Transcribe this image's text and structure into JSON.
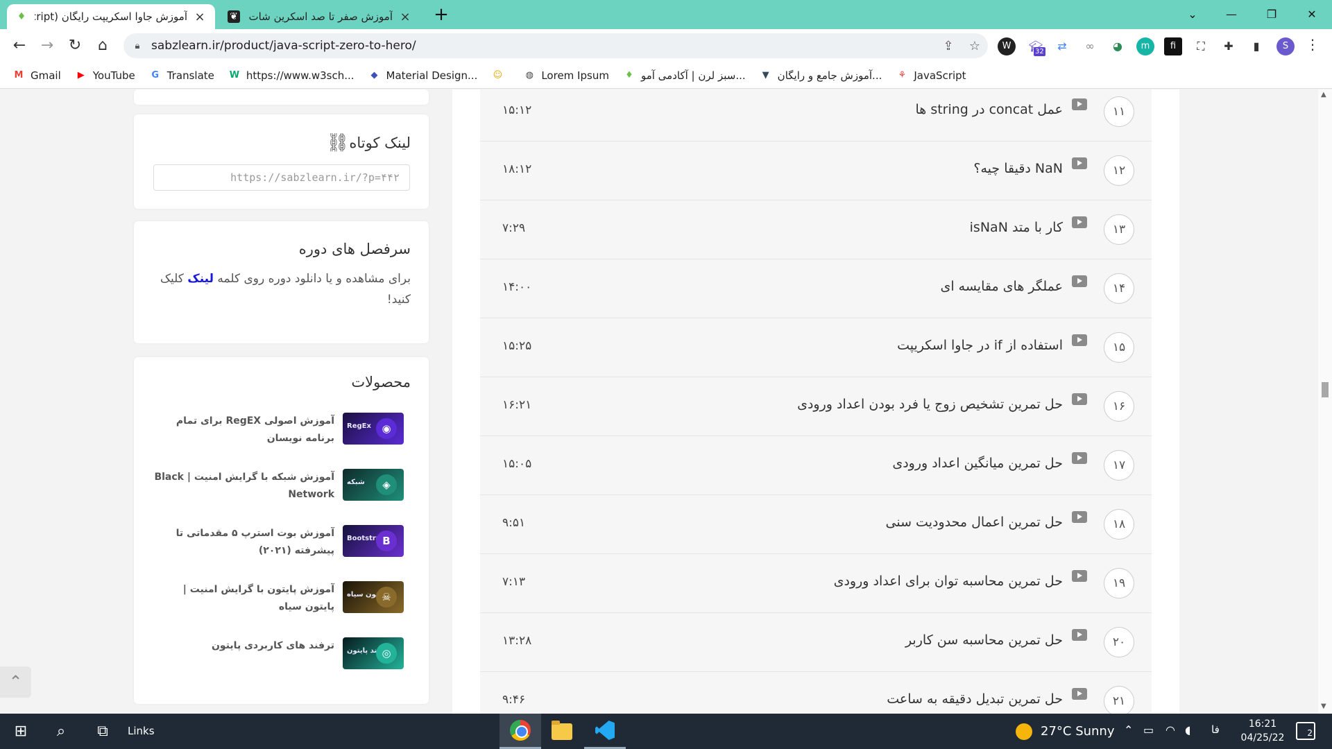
{
  "tabs": [
    {
      "title": "آموزش جاوا اسکریپت رایگان (Script"
    },
    {
      "title": "آموزش صفر تا صد اسکرین شات در"
    }
  ],
  "window": {
    "minimize": "—",
    "maximize": "❐",
    "close": "✕",
    "dropdown": "⌄",
    "newtab": "+"
  },
  "address": {
    "url": "sabzlearn.ir/product/java-script-zero-to-hero/"
  },
  "extensions": {
    "badge_count": "32",
    "profile_initial": "S"
  },
  "bookmarks": [
    {
      "label": "Gmail",
      "icon": "gmail-icon",
      "glyph": "M",
      "color": "#ea4335"
    },
    {
      "label": "YouTube",
      "icon": "youtube-icon",
      "glyph": "▶",
      "color": "#ff0000"
    },
    {
      "label": "Translate",
      "icon": "translate-icon",
      "glyph": "G",
      "color": "#4285f4"
    },
    {
      "label": "https://www.w3sch...",
      "icon": "w3schools-icon",
      "glyph": "W",
      "color": "#04aa6d"
    },
    {
      "label": "Material Design...",
      "icon": "material-icon",
      "glyph": "◆",
      "color": "#3f51b5"
    },
    {
      "label": "",
      "icon": "emoji-icon",
      "glyph": "☺",
      "color": "#e9a800"
    },
    {
      "label": "Lorem Ipsum",
      "icon": "globe-icon",
      "glyph": "◍",
      "color": "#444444"
    },
    {
      "label": "سبز لرن | آکادمی آمو...",
      "icon": "sabzlearn-icon",
      "glyph": "♦",
      "color": "#6cc04a"
    },
    {
      "label": "آموزش جامع و رایگان...",
      "icon": "vue-icon",
      "glyph": "▼",
      "color": "#35495e"
    },
    {
      "label": "JavaScript",
      "icon": "javascript-icon",
      "glyph": "⚘",
      "color": "#e53935"
    }
  ],
  "sidebar": {
    "short_link": {
      "title": "لینک کوتاه",
      "value": "https://sabzlearn.ir/?p=۴۴۲"
    },
    "syllabus": {
      "title": "سرفصل های دوره",
      "text_before": "برای مشاهده و یا دانلود دوره روی کلمه",
      "link": "لینک",
      "text_after": "کلیک کنید!"
    },
    "products_title": "محصولات",
    "products": [
      {
        "name": "آموزش اصولی RegEX برای تمام برنامه نویسان",
        "thumb_label": "RegEx",
        "thumb_glyph": "◉"
      },
      {
        "name": "آموزش شبکه با گرایش امنیت | Black Network",
        "thumb_label": "شبکه",
        "thumb_glyph": "◈"
      },
      {
        "name": "آموزش بوت استرپ ۵ مقدماتی تا پیشرفته (۲۰۲۱)",
        "thumb_label": "Bootstrap",
        "thumb_glyph": "B"
      },
      {
        "name": "آموزش پایتون با گرایش امنیت | پایتون سیاه",
        "thumb_label": "پایتون سیاه",
        "thumb_glyph": "☠"
      },
      {
        "name": "ترفند های کاربردی پایتون",
        "thumb_label": "ترفند پایتون",
        "thumb_glyph": "◎"
      }
    ]
  },
  "lessons": [
    {
      "num": "۱۱",
      "title": "عمل concat در string ها",
      "duration": "۱۵:۱۲"
    },
    {
      "num": "۱۲",
      "title": "NaN دقیقا چیه؟",
      "duration": "۱۸:۱۲"
    },
    {
      "num": "۱۳",
      "title": "کار با متد isNaN",
      "duration": "۷:۲۹"
    },
    {
      "num": "۱۴",
      "title": "عملگر های مقایسه ای",
      "duration": "۱۴:۰۰"
    },
    {
      "num": "۱۵",
      "title": "استفاده از if در جاوا اسکریپت",
      "duration": "۱۵:۲۵"
    },
    {
      "num": "۱۶",
      "title": "حل تمرین تشخیص زوج یا فرد بودن اعداد ورودی",
      "duration": "۱۶:۲۱"
    },
    {
      "num": "۱۷",
      "title": "حل تمرین میانگین اعداد ورودی",
      "duration": "۱۵:۰۵"
    },
    {
      "num": "۱۸",
      "title": "حل تمرین اعمال محدودیت سنی",
      "duration": "۹:۵۱"
    },
    {
      "num": "۱۹",
      "title": "حل تمرین محاسبه توان برای اعداد ورودی",
      "duration": "۷:۱۳"
    },
    {
      "num": "۲۰",
      "title": "حل تمرین محاسبه سن کاربر",
      "duration": "۱۳:۲۸"
    },
    {
      "num": "۲۱",
      "title": "حل تمرین تبدیل دقیقه به ساعت",
      "duration": "۹:۴۶"
    }
  ],
  "taskbar": {
    "links_label": "Links",
    "weather": "27°C  Sunny",
    "lang": "فا",
    "time": "16:21",
    "date": "04/25/22",
    "notifications": "2"
  },
  "colors": {
    "tabbar": "#6dd3c1",
    "link": "#1a1ad8",
    "taskbar": "#1f2a36"
  }
}
